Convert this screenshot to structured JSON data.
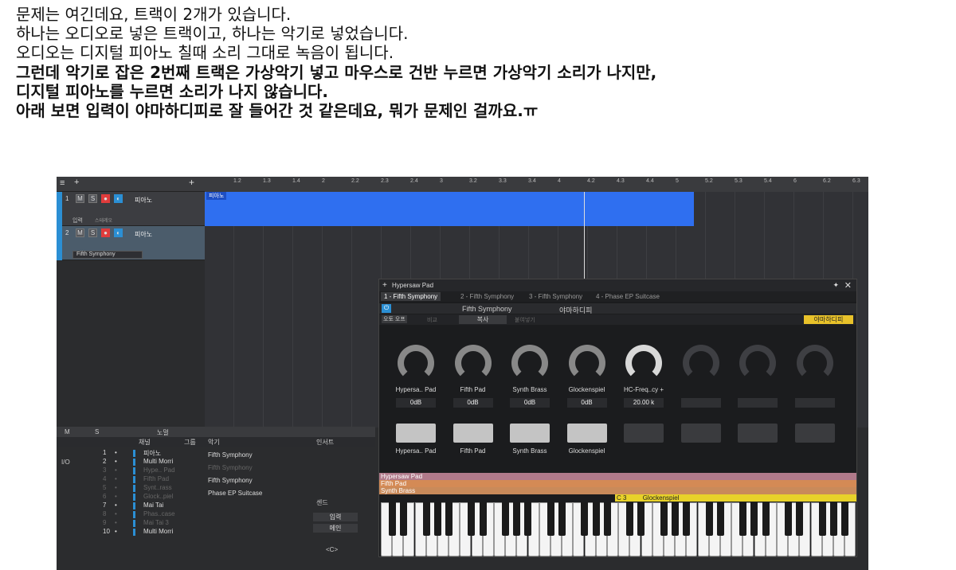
{
  "question": {
    "line1": "문제는 여긴데요, 트랙이 2개가 있습니다.",
    "line2": "하나는 오디오로 넣은 트랙이고, 하나는 악기로 넣었습니다.",
    "line3": "오디오는 디지털 피아노 칠때 소리 그대로 녹음이 됩니다.",
    "line4": "그런데 악기로 잡은 2번째 트랙은 가상악기 넣고 마우스로 건반 누르면 가상악기 소리가 나지만,",
    "line5": "디지털 피아노를 누르면 소리가 나지 않습니다.",
    "line6": "아래 보면 입력이 야마하디피로 잘 들어간 것 같은데요, 뭐가 문제인 걸까요.ㅠ"
  },
  "ruler": [
    "1.2",
    "1.3",
    "1.4",
    "2",
    "2.2",
    "2.3",
    "2.4",
    "3",
    "3.2",
    "3.3",
    "3.4",
    "4",
    "4.2",
    "4.3",
    "4.4",
    "5",
    "5.2",
    "5.3",
    "5.4",
    "6",
    "6.2",
    "6.3"
  ],
  "tracks": [
    {
      "num": "1",
      "m": "M",
      "s": "S",
      "name": "피아노",
      "input": "입력",
      "stereo": "스테레오"
    },
    {
      "num": "2",
      "m": "M",
      "s": "S",
      "name": "피아노",
      "instrument": "Fifth Symphony"
    }
  ],
  "clip_label": "피아노",
  "plugin": {
    "title": "Hypersaw Pad",
    "tabs": [
      "1 - Fifth Symphony",
      "2 - Fifth Symphony",
      "3 - Fifth Symphony",
      "4 - Phase EP Suitcase"
    ],
    "preset": "Fifth Symphony",
    "input": "야마하디피",
    "auto_on": "오토 오프",
    "compare": "비교",
    "copy": "복사",
    "paste": "붙여넣기",
    "input_badge": "야마하디피",
    "knobs": [
      {
        "label": "Hypersa.. Pad",
        "value": "0dB"
      },
      {
        "label": "Fifth Pad",
        "value": "0dB"
      },
      {
        "label": "Synth Brass",
        "value": "0dB"
      },
      {
        "label": "Glockenspiel",
        "value": "0dB"
      },
      {
        "label": "HC-Freq..cy +",
        "value": "20.00 k"
      }
    ],
    "pads": [
      "Hypersa.. Pad",
      "Fifth Pad",
      "Synth Brass",
      "Glockenspiel"
    ],
    "zones": [
      "Hypersaw Pad",
      "Fifth Pad",
      "Synth Brass"
    ],
    "zone4_note": "C 3",
    "zone4_name": "Glockenspiel",
    "colors": {
      "zone1": "#b07a8a",
      "zone2": "#d48a55",
      "zone3": "#c98a5a",
      "zone4": "#e8d22a"
    }
  },
  "mixer": {
    "hdr_m": "M",
    "hdr_s": "S",
    "hdr_norm": "노멀",
    "col_channel": "채널",
    "col_group": "그룹",
    "col_inst": "악기",
    "io": "I/O",
    "insert": "인서트",
    "send": "센드",
    "input_btn": "입력",
    "main_btn": "메인",
    "pan": "<C>",
    "channels": [
      {
        "n": "1",
        "name": "피아노",
        "dim": false
      },
      {
        "n": "2",
        "name": "Multi Morri",
        "dim": false
      },
      {
        "n": "3",
        "name": "Hype.. Pad",
        "dim": true
      },
      {
        "n": "4",
        "name": "Fifth Pad",
        "dim": true
      },
      {
        "n": "5",
        "name": "Synt..rass",
        "dim": true
      },
      {
        "n": "6",
        "name": "Glock..piel",
        "dim": true
      },
      {
        "n": "7",
        "name": "Mai Tai",
        "dim": false
      },
      {
        "n": "8",
        "name": "Phas..case",
        "dim": true
      },
      {
        "n": "9",
        "name": "Mai Tai 3",
        "dim": true
      },
      {
        "n": "10",
        "name": "Multi Morri",
        "dim": false
      }
    ],
    "instruments": [
      {
        "name": "Fifth Symphony",
        "dim": false
      },
      {
        "name": "Fifth Symphony",
        "dim": true
      },
      {
        "name": "Fifth Symphony",
        "dim": false
      },
      {
        "name": "Phase EP Suitcase",
        "dim": false
      }
    ]
  }
}
